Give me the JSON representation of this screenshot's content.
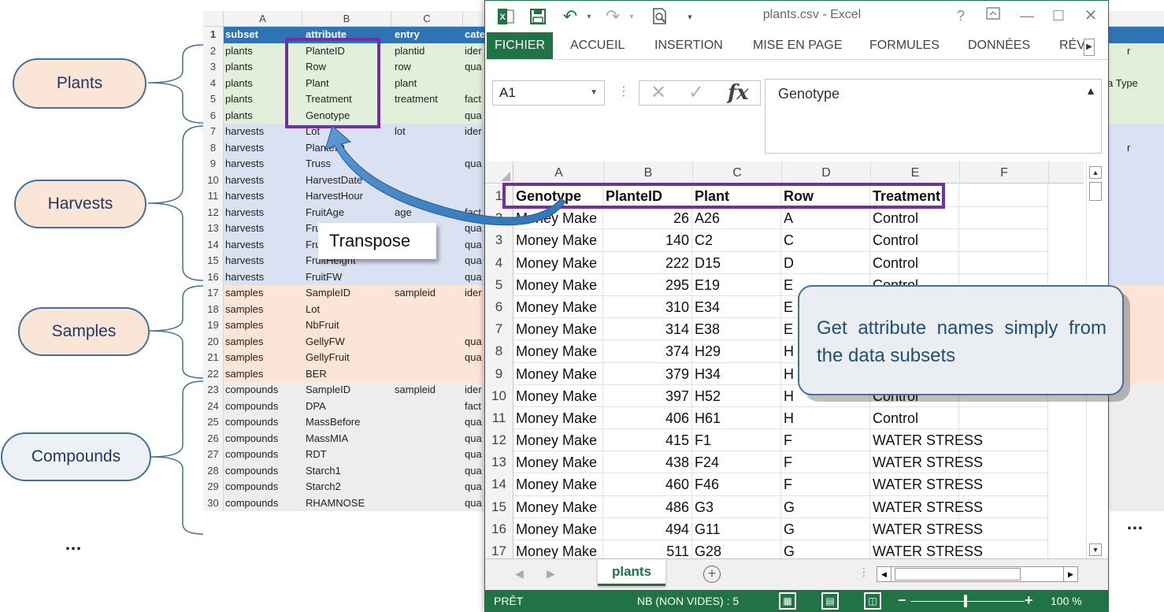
{
  "background_sheet": {
    "columns": [
      "A",
      "B",
      "C"
    ],
    "side_texts": [
      "r",
      "a Type",
      "r"
    ],
    "rows": [
      {
        "num": "1",
        "subset": "subset",
        "attribute": "attribute",
        "entry": "entry",
        "category": "cate",
        "group": "header"
      },
      {
        "num": "2",
        "subset": "plants",
        "attribute": "PlanteID",
        "entry": "plantid",
        "category": "ider",
        "group": "plants"
      },
      {
        "num": "3",
        "subset": "plants",
        "attribute": "Row",
        "entry": "row",
        "category": "qua",
        "group": "plants"
      },
      {
        "num": "4",
        "subset": "plants",
        "attribute": "Plant",
        "entry": "plant",
        "category": "",
        "group": "plants"
      },
      {
        "num": "5",
        "subset": "plants",
        "attribute": "Treatment",
        "entry": "treatment",
        "category": "fact",
        "group": "plants"
      },
      {
        "num": "6",
        "subset": "plants",
        "attribute": "Genotype",
        "entry": "",
        "category": "qua",
        "group": "plants"
      },
      {
        "num": "7",
        "subset": "harvests",
        "attribute": "Lot",
        "entry": "lot",
        "category": "ider",
        "group": "harvests"
      },
      {
        "num": "8",
        "subset": "harvests",
        "attribute": "PlanteID",
        "entry": "",
        "category": "",
        "group": "harvests"
      },
      {
        "num": "9",
        "subset": "harvests",
        "attribute": "Truss",
        "entry": "",
        "category": "qua",
        "group": "harvests"
      },
      {
        "num": "10",
        "subset": "harvests",
        "attribute": "HarvestDate",
        "entry": "",
        "category": "",
        "group": "harvests"
      },
      {
        "num": "11",
        "subset": "harvests",
        "attribute": "HarvestHour",
        "entry": "",
        "category": "",
        "group": "harvests"
      },
      {
        "num": "12",
        "subset": "harvests",
        "attribute": "FruitAge",
        "entry": "age",
        "category": "fact",
        "group": "harvests"
      },
      {
        "num": "13",
        "subset": "harvests",
        "attribute": "Fru",
        "entry": "",
        "category": "qua",
        "group": "harvests"
      },
      {
        "num": "14",
        "subset": "harvests",
        "attribute": "Fru",
        "entry": "",
        "category": "qua",
        "group": "harvests"
      },
      {
        "num": "15",
        "subset": "harvests",
        "attribute": "FruitHeight",
        "entry": "",
        "category": "qua",
        "group": "harvests"
      },
      {
        "num": "16",
        "subset": "harvests",
        "attribute": "FruitFW",
        "entry": "",
        "category": "qua",
        "group": "harvests"
      },
      {
        "num": "17",
        "subset": "samples",
        "attribute": "SampleID",
        "entry": "sampleid",
        "category": "ider",
        "group": "samples"
      },
      {
        "num": "18",
        "subset": "samples",
        "attribute": "Lot",
        "entry": "",
        "category": "",
        "group": "samples"
      },
      {
        "num": "19",
        "subset": "samples",
        "attribute": "NbFruit",
        "entry": "",
        "category": "",
        "group": "samples"
      },
      {
        "num": "20",
        "subset": "samples",
        "attribute": "GellyFW",
        "entry": "",
        "category": "qua",
        "group": "samples"
      },
      {
        "num": "21",
        "subset": "samples",
        "attribute": "GellyFruit",
        "entry": "",
        "category": "qua",
        "group": "samples"
      },
      {
        "num": "22",
        "subset": "samples",
        "attribute": "BER",
        "entry": "",
        "category": "",
        "group": "samples"
      },
      {
        "num": "23",
        "subset": "compounds",
        "attribute": "SampleID",
        "entry": "sampleid",
        "category": "ider",
        "group": "compounds"
      },
      {
        "num": "24",
        "subset": "compounds",
        "attribute": "DPA",
        "entry": "",
        "category": "fact",
        "group": "compounds"
      },
      {
        "num": "25",
        "subset": "compounds",
        "attribute": "MassBefore",
        "entry": "",
        "category": "qua",
        "group": "compounds"
      },
      {
        "num": "26",
        "subset": "compounds",
        "attribute": "MassMIA",
        "entry": "",
        "category": "qua",
        "group": "compounds"
      },
      {
        "num": "27",
        "subset": "compounds",
        "attribute": "RDT",
        "entry": "",
        "category": "qua",
        "group": "compounds"
      },
      {
        "num": "28",
        "subset": "compounds",
        "attribute": "Starch1",
        "entry": "",
        "category": "qua",
        "group": "compounds"
      },
      {
        "num": "29",
        "subset": "compounds",
        "attribute": "Starch2",
        "entry": "",
        "category": "qua",
        "group": "compounds"
      },
      {
        "num": "30",
        "subset": "compounds",
        "attribute": "RHAMNOSE",
        "entry": "",
        "category": "qua",
        "group": "compounds"
      }
    ]
  },
  "callouts": {
    "groups": [
      "Plants",
      "Harvests",
      "Samples",
      "Compounds"
    ],
    "left_ellipsis": "…",
    "right_ellipsis": "…",
    "transpose": "Transpose",
    "note": "Get attribute names simply from the data subsets"
  },
  "excel": {
    "title": "plants.csv - Excel",
    "help": "?",
    "ribbon_tabs": [
      "FICHIER",
      "ACCUEIL",
      "INSERTION",
      "MISE EN PAGE",
      "FORMULES",
      "DONNÉES",
      "RÉVIS"
    ],
    "name_box": "A1",
    "formula": "Genotype",
    "columns": [
      "A",
      "B",
      "C",
      "D",
      "E",
      "F"
    ],
    "header_row": {
      "num": "1",
      "a": "Genotype",
      "b": "PlanteID",
      "c": "Plant",
      "d": "Row",
      "e": "Treatment"
    },
    "rows": [
      {
        "num": "2",
        "a": "Money Make",
        "b": "26",
        "c": "A26",
        "d": "A",
        "e": "Control"
      },
      {
        "num": "3",
        "a": "Money Make",
        "b": "140",
        "c": "C2",
        "d": "C",
        "e": "Control"
      },
      {
        "num": "4",
        "a": "Money Make",
        "b": "222",
        "c": "D15",
        "d": "D",
        "e": "Control"
      },
      {
        "num": "5",
        "a": "Money Make",
        "b": "295",
        "c": "E19",
        "d": "E",
        "e": "Control"
      },
      {
        "num": "6",
        "a": "Money Make",
        "b": "310",
        "c": "E34",
        "d": "E",
        "e": ""
      },
      {
        "num": "7",
        "a": "Money Make",
        "b": "314",
        "c": "E38",
        "d": "E",
        "e": ""
      },
      {
        "num": "8",
        "a": "Money Make",
        "b": "374",
        "c": "H29",
        "d": "H",
        "e": ""
      },
      {
        "num": "9",
        "a": "Money Make",
        "b": "379",
        "c": "H34",
        "d": "H",
        "e": ""
      },
      {
        "num": "10",
        "a": "Money Make",
        "b": "397",
        "c": "H52",
        "d": "H",
        "e": "Control"
      },
      {
        "num": "11",
        "a": "Money Make",
        "b": "406",
        "c": "H61",
        "d": "H",
        "e": "Control"
      },
      {
        "num": "12",
        "a": "Money Make",
        "b": "415",
        "c": "F1",
        "d": "F",
        "e": "WATER STRESS"
      },
      {
        "num": "13",
        "a": "Money Make",
        "b": "438",
        "c": "F24",
        "d": "F",
        "e": "WATER STRESS"
      },
      {
        "num": "14",
        "a": "Money Make",
        "b": "460",
        "c": "F46",
        "d": "F",
        "e": "WATER STRESS"
      },
      {
        "num": "15",
        "a": "Money Make",
        "b": "486",
        "c": "G3",
        "d": "G",
        "e": "WATER STRESS"
      },
      {
        "num": "16",
        "a": "Money Make",
        "b": "494",
        "c": "G11",
        "d": "G",
        "e": "WATER STRESS"
      },
      {
        "num": "17",
        "a": "Money Make",
        "b": "511",
        "c": "G28",
        "d": "G",
        "e": "WATER STRESS"
      }
    ],
    "sheet_tab": "plants",
    "status_ready": "PRÊT",
    "status_count": "NB (NON VIDES) : 5",
    "zoom": "100 %",
    "icons": [
      "excel-logo-icon",
      "save-icon",
      "undo-icon",
      "redo-icon",
      "print-preview-icon",
      "customize-icon",
      "help-icon",
      "restore-ribbon-icon",
      "minimize-icon",
      "maximize-icon",
      "close-icon"
    ]
  },
  "colors": {
    "excel_green": "#217346",
    "highlight_purple": "#7030a0",
    "callout_border": "#41719c",
    "plants_bg": "#e2efda",
    "harvests_bg": "#d9e1f2",
    "samples_bg": "#fce4d6",
    "compounds_bg": "#ededed"
  }
}
